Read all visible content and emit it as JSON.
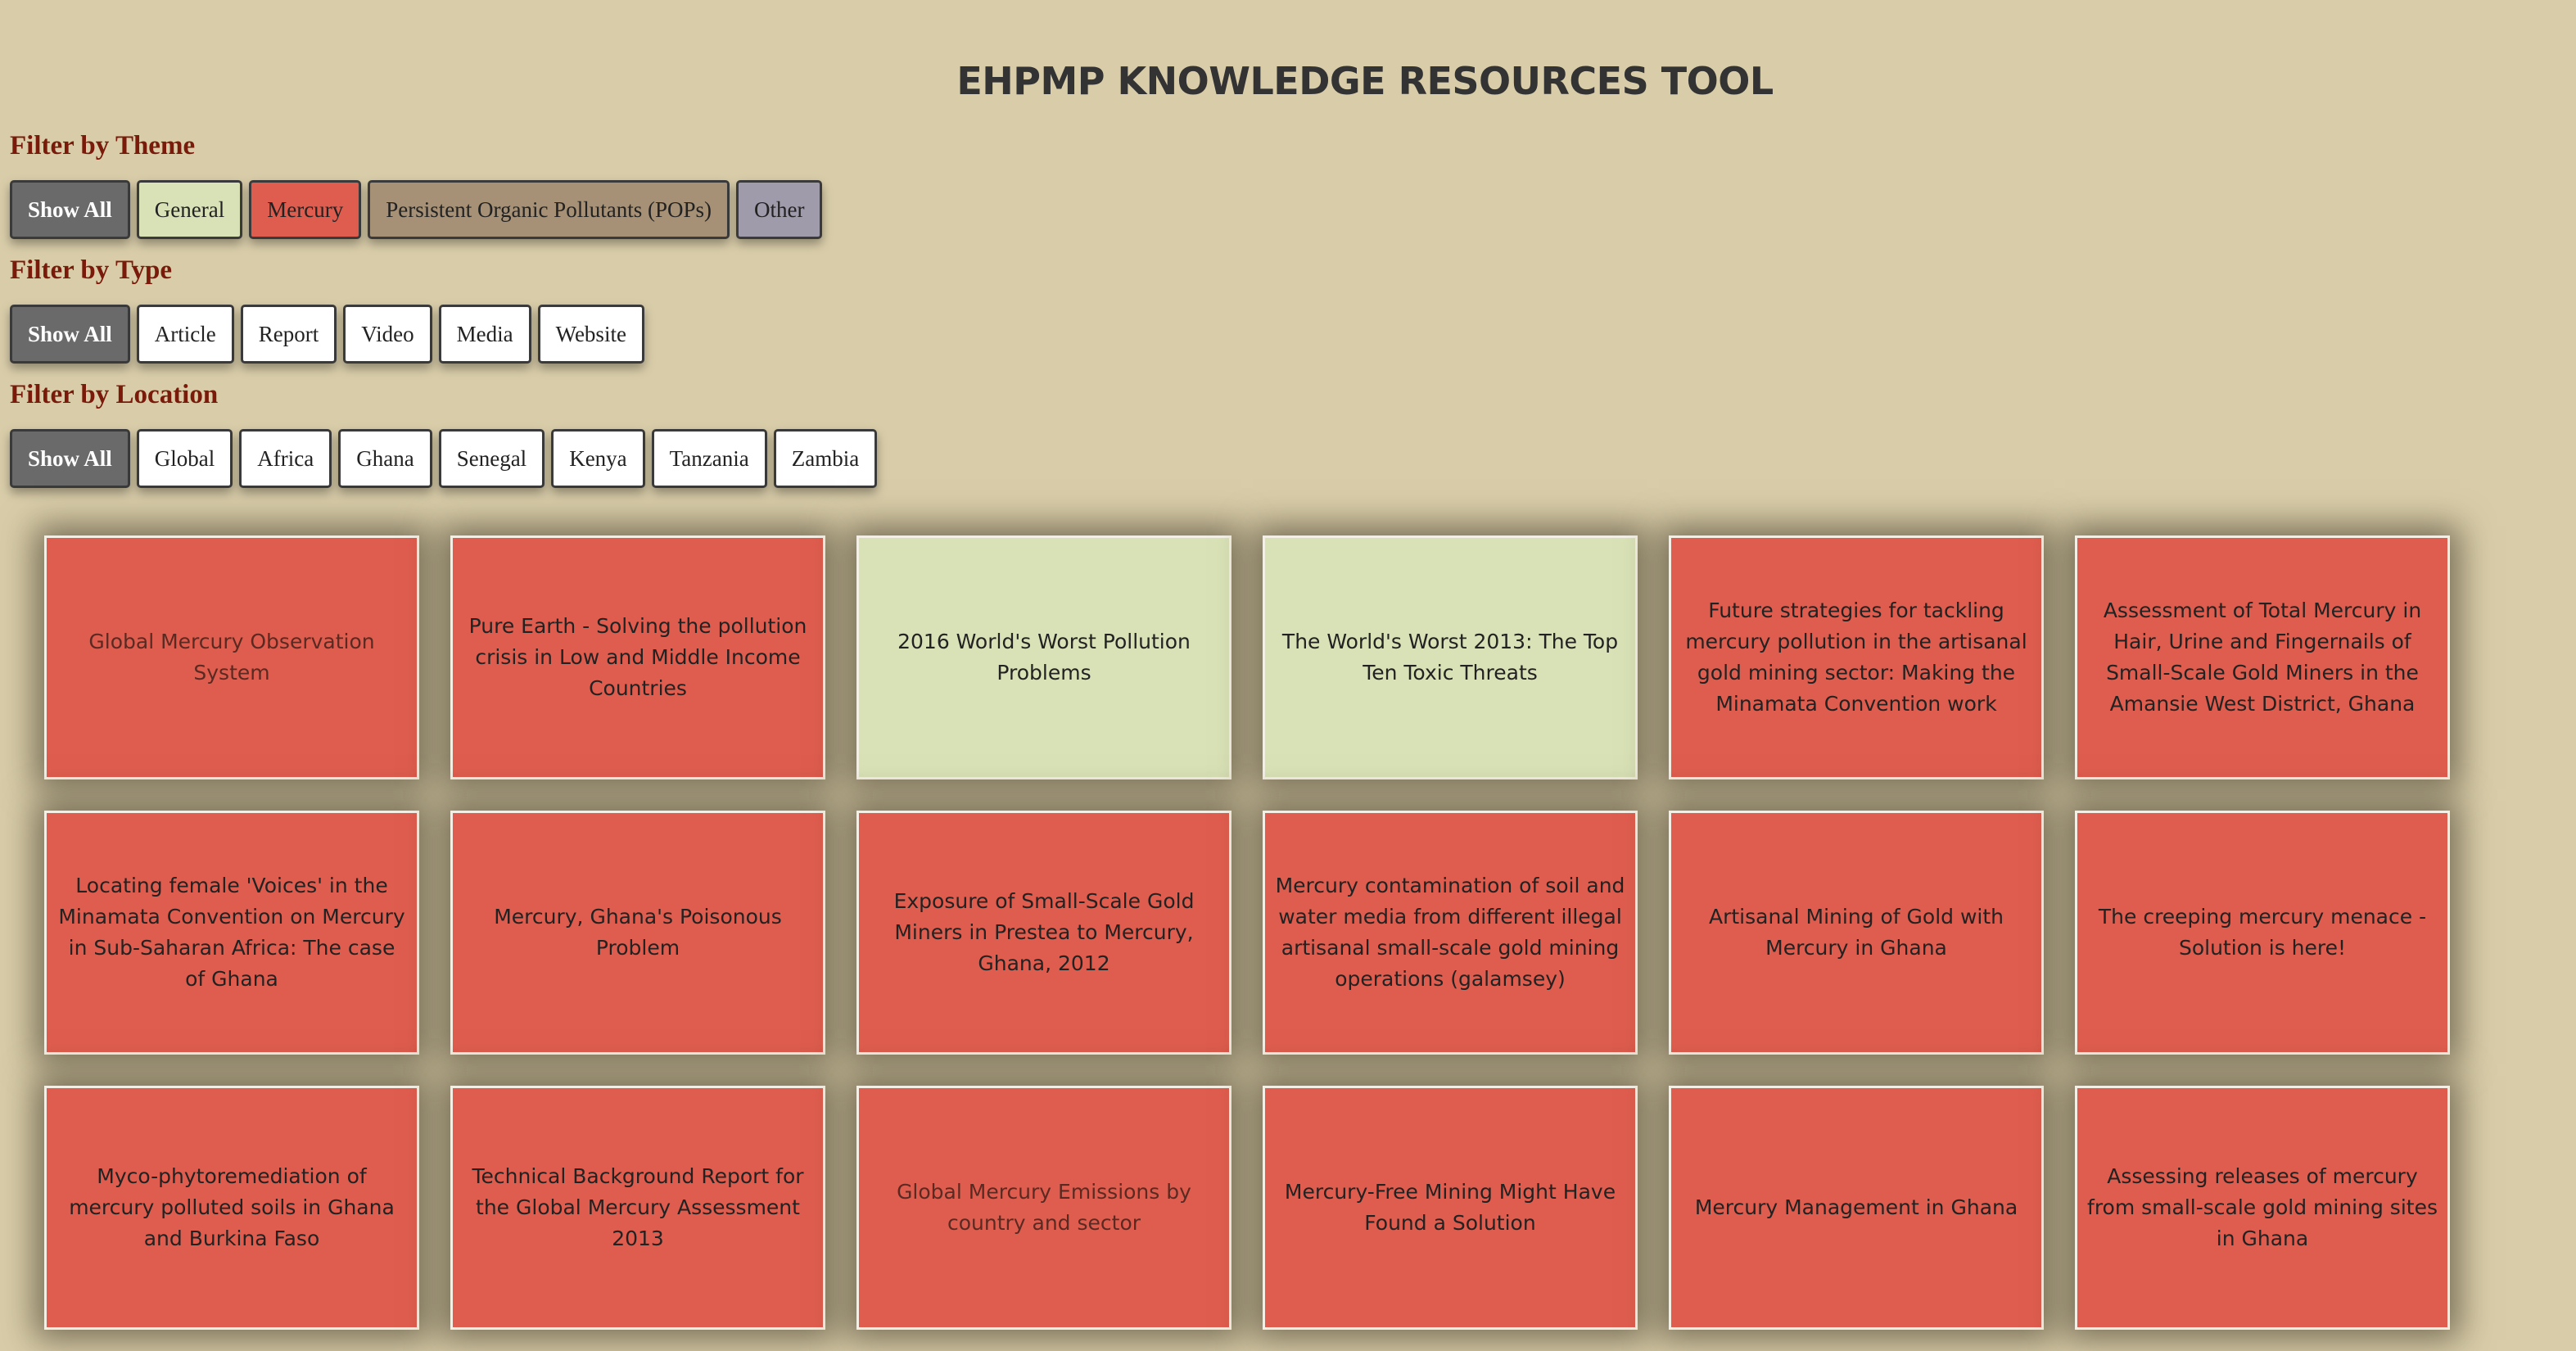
{
  "app": {
    "title": "EHPMP KNOWLEDGE RESOURCES TOOL"
  },
  "colors": {
    "background": "#d9cda9",
    "mercury": "#df5d4e",
    "general": "#d9e1b6",
    "pops": "#a69176",
    "other": "#a09bab",
    "active_button": "#6a6a6a",
    "label": "#7a1a0a"
  },
  "theme_filter": {
    "label": "Filter by Theme",
    "buttons": [
      {
        "label": "Show All",
        "active": true,
        "color": "#6a6a6a"
      },
      {
        "label": "General",
        "active": false,
        "color": "#d9e1b6"
      },
      {
        "label": "Mercury",
        "active": false,
        "color": "#df5d4e"
      },
      {
        "label": "Persistent Organic Pollutants (POPs)",
        "active": false,
        "color": "#a69176"
      },
      {
        "label": "Other",
        "active": false,
        "color": "#a09bab"
      }
    ]
  },
  "type_filter": {
    "label": "Filter by Type",
    "buttons": [
      {
        "label": "Show All",
        "active": true
      },
      {
        "label": "Article",
        "active": false
      },
      {
        "label": "Report",
        "active": false
      },
      {
        "label": "Video",
        "active": false
      },
      {
        "label": "Media",
        "active": false
      },
      {
        "label": "Website",
        "active": false
      }
    ]
  },
  "location_filter": {
    "label": "Filter by Location",
    "buttons": [
      {
        "label": "Show All",
        "active": true
      },
      {
        "label": "Global",
        "active": false
      },
      {
        "label": "Africa",
        "active": false
      },
      {
        "label": "Ghana",
        "active": false
      },
      {
        "label": "Senegal",
        "active": false
      },
      {
        "label": "Kenya",
        "active": false
      },
      {
        "label": "Tanzania",
        "active": false
      },
      {
        "label": "Zambia",
        "active": false
      }
    ]
  },
  "resources": [
    {
      "title": "Global Mercury Observation System",
      "theme": "mercury",
      "dim": true
    },
    {
      "title": "Pure Earth - Solving the pollution crisis in Low and Middle Income Countries",
      "theme": "mercury",
      "dim": false
    },
    {
      "title": "2016 World's Worst Pollution Problems",
      "theme": "general",
      "dim": false
    },
    {
      "title": "The World's Worst 2013: The Top Ten Toxic Threats",
      "theme": "general",
      "dim": false
    },
    {
      "title": "Future strategies for tackling mercury pollution in the artisanal gold mining sector: Making the Minamata Convention work",
      "theme": "mercury",
      "dim": false
    },
    {
      "title": "Assessment of Total Mercury in Hair, Urine and Fingernails of Small-Scale Gold Miners in the Amansie West District, Ghana",
      "theme": "mercury",
      "dim": false
    },
    {
      "title": "Locating female 'Voices' in the Minamata Convention on Mercury in Sub-Saharan Africa: The case of Ghana",
      "theme": "mercury",
      "dim": false
    },
    {
      "title": "Mercury, Ghana's Poisonous Problem",
      "theme": "mercury",
      "dim": false
    },
    {
      "title": "Exposure of Small-Scale Gold Miners in Prestea to Mercury, Ghana, 2012",
      "theme": "mercury",
      "dim": false
    },
    {
      "title": "Mercury contamination of soil and water media from different illegal artisanal small-scale gold mining operations (galamsey)",
      "theme": "mercury",
      "dim": false
    },
    {
      "title": "Artisanal Mining of Gold with Mercury in Ghana",
      "theme": "mercury",
      "dim": false
    },
    {
      "title": "The creeping mercury menace - Solution is here!",
      "theme": "mercury",
      "dim": false
    },
    {
      "title": "Myco-phytoremediation of mercury polluted soils in Ghana and Burkina Faso",
      "theme": "mercury",
      "dim": false
    },
    {
      "title": "Technical Background Report for the Global Mercury Assessment 2013",
      "theme": "mercury",
      "dim": false
    },
    {
      "title": "Global Mercury Emissions by country and sector",
      "theme": "mercury",
      "dim": true
    },
    {
      "title": "Mercury-Free Mining Might Have Found a Solution",
      "theme": "mercury",
      "dim": false
    },
    {
      "title": "Mercury Management in Ghana",
      "theme": "mercury",
      "dim": false
    },
    {
      "title": "Assessing releases of mercury from small-scale gold mining sites in Ghana",
      "theme": "mercury",
      "dim": false
    }
  ]
}
